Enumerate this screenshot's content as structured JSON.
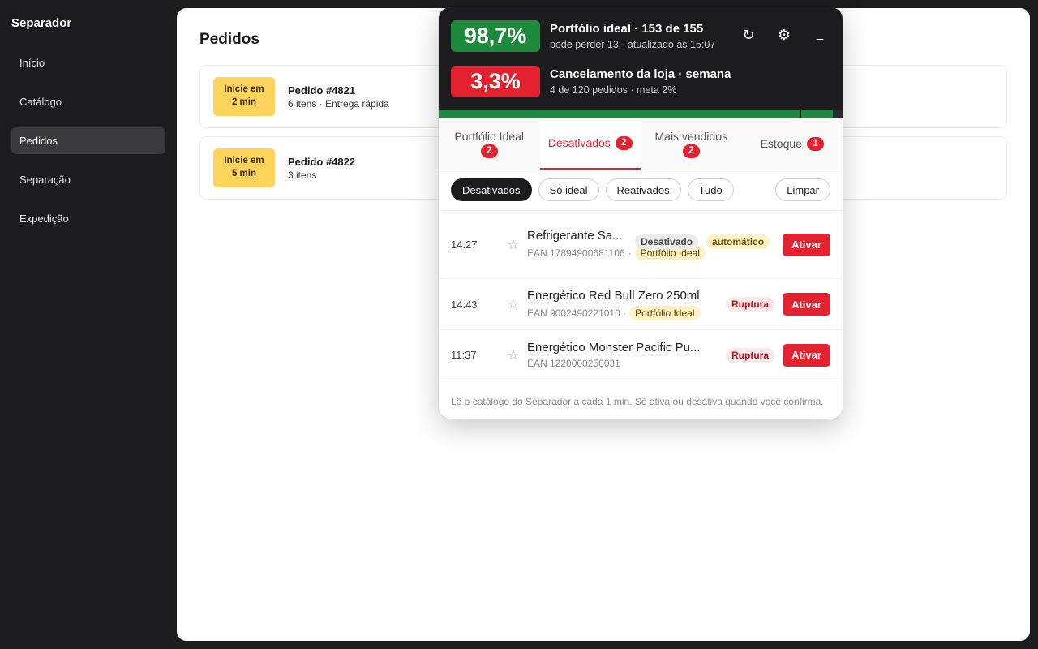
{
  "sidebar": {
    "brand": "Separador",
    "items": [
      {
        "label": "Início"
      },
      {
        "label": "Catálogo"
      },
      {
        "label": "Pedidos"
      },
      {
        "label": "Separação"
      },
      {
        "label": "Expedição"
      }
    ]
  },
  "main": {
    "title": "Pedidos",
    "orders": [
      {
        "badge_line1": "Inicie em",
        "badge_line2": "2 min",
        "title": "Pedido #4821",
        "sub": "6 itens · Entrega rápida"
      },
      {
        "badge_line1": "Inicie em",
        "badge_line2": "5 min",
        "title": "Pedido #4822",
        "sub": "3 itens"
      }
    ]
  },
  "popup": {
    "metric1": {
      "value": "98,7%",
      "title": "Portfólio ideal · 153 de 155",
      "sub": "pode perder 13 · atualizado às 15:07",
      "color": "#1e8a3c"
    },
    "metric2": {
      "value": "3,3%",
      "title": "Cancelamento da loja · semana",
      "sub": "4 de 120 pedidos · meta 2%",
      "color": "#e32230"
    },
    "actions": {
      "refresh": "↻",
      "settings": "⚙",
      "minimize": "_"
    },
    "progress": {
      "fill_pct": 98.7,
      "marker_pct": 90.5
    },
    "tabs": [
      {
        "label": "Portfólio Ideal",
        "count": "2"
      },
      {
        "label": "Desativados",
        "count": "2"
      },
      {
        "label": "Mais vendidos",
        "count": "2"
      },
      {
        "label": "Estoque",
        "count": "1"
      }
    ],
    "filters": [
      "Desativados",
      "Só ideal",
      "Reativados",
      "Tudo"
    ],
    "clear_label": "Limpar",
    "rows": [
      {
        "time": "14:27",
        "name": "Refrigerante Sa...",
        "ean": "EAN 17894900681106",
        "sep": "·",
        "portfolio": "Portfólio Ideal",
        "tag1": "Desativado",
        "tag2": "automático",
        "action": "Ativar"
      },
      {
        "time": "14:43",
        "name": "Energético Red Bull Zero 250ml",
        "ean": "EAN 9002490221010 ·",
        "portfolio": "Portfólio Ideal",
        "tag1": "Ruptura",
        "action": "Ativar"
      },
      {
        "time": "11:37",
        "name": "Energético Monster Pacific Pu...",
        "ean": "EAN 1220000250031",
        "tag1": "Ruptura",
        "action": "Ativar"
      }
    ],
    "footer": "Lê o catálogo do Separador a cada 1 min. Só ativa ou desativa quando você confirma."
  }
}
